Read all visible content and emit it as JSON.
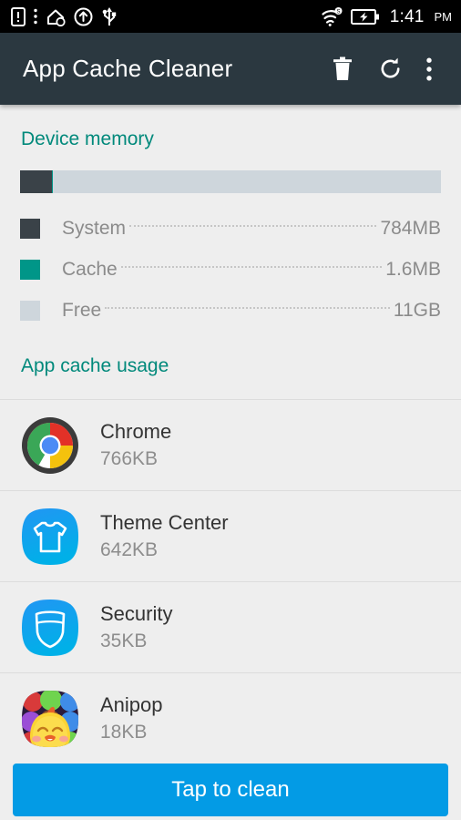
{
  "status_bar": {
    "icons": [
      "sim-alert-icon",
      "more-vert-icon",
      "upload-home-icon",
      "circle-up-arrow-icon",
      "usb-icon"
    ],
    "right_icons": [
      "wifi-s-icon",
      "battery-charging-icon"
    ],
    "time": "1:41",
    "ampm": "PM"
  },
  "app_bar": {
    "title": "App Cache Cleaner",
    "actions": [
      {
        "name": "delete-button",
        "icon": "trash-icon"
      },
      {
        "name": "refresh-button",
        "icon": "refresh-icon"
      },
      {
        "name": "overflow-menu-button",
        "icon": "more-vert-icon"
      }
    ]
  },
  "device_memory": {
    "title": "Device memory",
    "bar": {
      "system_percent": 7.5,
      "cache_percent": 0.4,
      "free_percent": 92.1
    },
    "legend": [
      {
        "label": "System",
        "value": "784MB",
        "color": "#3a4248"
      },
      {
        "label": "Cache",
        "value": "1.6MB",
        "color": "#009688"
      },
      {
        "label": "Free",
        "value": "11GB",
        "color": "#ced6dc"
      }
    ]
  },
  "app_cache": {
    "title": "App cache usage",
    "apps": [
      {
        "name": "Chrome",
        "size": "766KB",
        "icon": "chrome-icon"
      },
      {
        "name": "Theme Center",
        "size": "642KB",
        "icon": "tshirt-icon"
      },
      {
        "name": "Security",
        "size": "35KB",
        "icon": "shield-icon"
      },
      {
        "name": "Anipop",
        "size": "18KB",
        "icon": "anipop-icon"
      }
    ]
  },
  "bottom": {
    "clean_label": "Tap to clean"
  },
  "colors": {
    "accent_teal": "#00897b",
    "app_bar": "#2b3840",
    "button_blue": "#039be5",
    "background": "#eeeeee"
  }
}
